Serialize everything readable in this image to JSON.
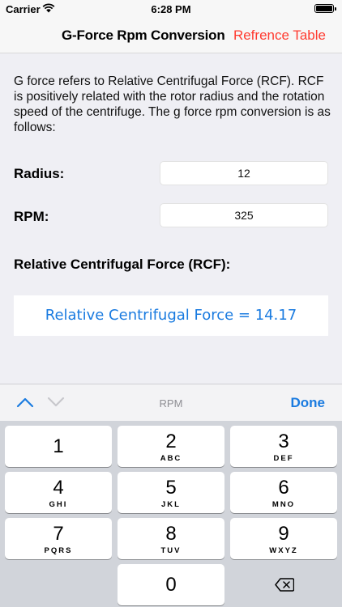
{
  "status_bar": {
    "carrier": "Carrier",
    "time": "6:28 PM",
    "icons": [
      "wifi-icon",
      "battery-icon"
    ]
  },
  "nav": {
    "title": "G-Force Rpm Conversion",
    "action": "Refrence Table",
    "action_color": "#ff3b30"
  },
  "description": "G force refers to Relative Centrifugal Force (RCF). RCF is positively related with the rotor radius and the rotation speed of the centrifuge. The g force rpm conversion is as follows:",
  "form": {
    "radius_label": "Radius:",
    "radius_value": "12",
    "rpm_label": "RPM:",
    "rpm_value": "325",
    "rcf_label": "Relative Centrifugal Force (RCF):",
    "result": "Relative Centrifugal Force = 14.17",
    "result_color": "#1a7be0"
  },
  "keyboard": {
    "toolbar": {
      "field_name": "RPM",
      "done": "Done",
      "icons": [
        "chevron-up-icon",
        "chevron-down-icon"
      ]
    },
    "keys": [
      {
        "num": "1",
        "letters": ""
      },
      {
        "num": "2",
        "letters": "ABC"
      },
      {
        "num": "3",
        "letters": "DEF"
      },
      {
        "num": "4",
        "letters": "GHI"
      },
      {
        "num": "5",
        "letters": "JKL"
      },
      {
        "num": "6",
        "letters": "MNO"
      },
      {
        "num": "7",
        "letters": "PQRS"
      },
      {
        "num": "8",
        "letters": "TUV"
      },
      {
        "num": "9",
        "letters": "WXYZ"
      },
      {
        "num": "0",
        "letters": ""
      }
    ],
    "delete_icon": "backspace-icon"
  }
}
